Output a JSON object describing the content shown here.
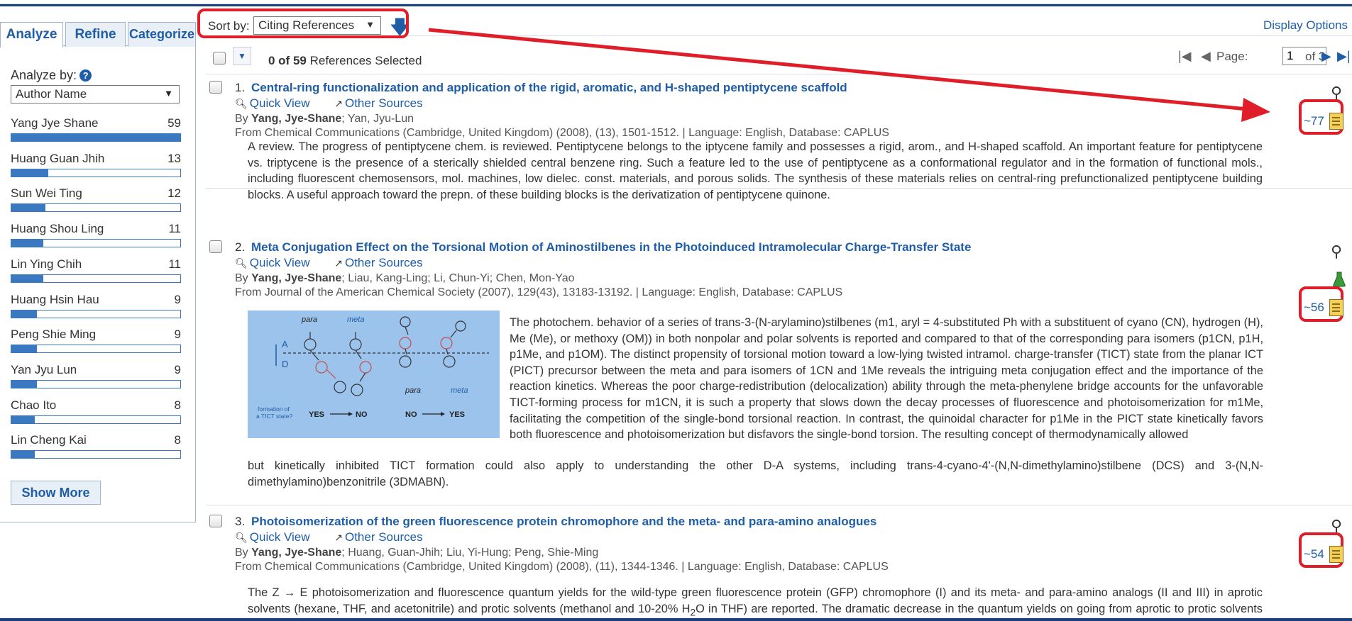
{
  "tabs": [
    {
      "label": "Analyze",
      "active": true
    },
    {
      "label": "Refine",
      "active": false
    },
    {
      "label": "Categorize",
      "active": false
    }
  ],
  "analyze": {
    "label": "Analyze by:",
    "select_value": "Author Name",
    "authors": [
      {
        "name": "Yang Jye Shane",
        "count": "59",
        "fraction": 1.0
      },
      {
        "name": "Huang Guan Jhih",
        "count": "13",
        "fraction": 0.22
      },
      {
        "name": "Sun Wei Ting",
        "count": "12",
        "fraction": 0.2
      },
      {
        "name": "Huang Shou Ling",
        "count": "11",
        "fraction": 0.19
      },
      {
        "name": "Lin Ying Chih",
        "count": "11",
        "fraction": 0.19
      },
      {
        "name": "Huang Hsin Hau",
        "count": "9",
        "fraction": 0.15
      },
      {
        "name": "Peng Shie Ming",
        "count": "9",
        "fraction": 0.15
      },
      {
        "name": "Yan Jyu Lun",
        "count": "9",
        "fraction": 0.15
      },
      {
        "name": "Chao Ito",
        "count": "8",
        "fraction": 0.14
      },
      {
        "name": "Lin Cheng Kai",
        "count": "8",
        "fraction": 0.14
      }
    ],
    "show_more": "Show More"
  },
  "sort": {
    "label": "Sort by:",
    "value": "Citing References",
    "direction_icon": "sort-descending-arrow"
  },
  "display_options": "Display Options",
  "selection": {
    "count": "0 of 59",
    "suffix": "References Selected"
  },
  "pager": {
    "label": "Page:",
    "value": "1",
    "of": "of 3"
  },
  "records": [
    {
      "num": "1.",
      "title": "Central-ring functionalization and application of the rigid, aromatic, and H-shaped pentiptycene scaffold",
      "quick_view": "Quick View",
      "other_sources": "Other Sources",
      "by_prefix": "By ",
      "by_bold": "Yang, Jye-Shane",
      "by_rest": "; Yan, Jyu-Lun",
      "from": "From Chemical Communications (Cambridge, United Kingdom) (2008), (13), 1501-1512.  |  Language: English, Database: CAPLUS",
      "abstract": "A review.  The progress of pentiptycene chem. is reviewed.  Pentiptycene belongs to the iptycene family and possesses a rigid, arom., and H-shaped scaffold.  An important feature for pentiptycene vs. triptycene is the presence of a sterically shielded central benzene ring.  Such a feature led to the use of pentiptycene as a conformational regulator and in the formation of functional mols., including fluorescent chemosensors, mol. machines, low dielec. const. materials, and porous solids.  The synthesis of these materials relies on central-ring prefunctionalized pentiptycene building blocks.  A useful approach toward the prepn. of these building blocks is the derivatization of pentiptycene quinone.",
      "cites": "~77"
    },
    {
      "num": "2.",
      "title": "Meta Conjugation Effect on the Torsional Motion of Aminostilbenes in the Photoinduced Intramolecular Charge-Transfer State",
      "quick_view": "Quick View",
      "other_sources": "Other Sources",
      "by_prefix": "By ",
      "by_bold": "Yang, Jye-Shane",
      "by_rest": "; Liau, Kang-Ling; Li, Chun-Yi; Chen, Mon-Yao",
      "from": "From Journal of the American Chemical Society (2007), 129(43), 13183-13192.  |  Language: English, Database: CAPLUS",
      "abstract": "The photochem. behavior of a series of trans-3-(N-arylamino)stilbenes (m1, aryl = 4-substituted Ph with a substituent of cyano (CN), hydrogen (H), Me (Me), or methoxy (OM)) in both nonpolar and polar solvents is reported and compared to that of the corresponding para isomers (p1CN, p1H, p1Me, and p1OM).  The distinct propensity of torsional motion toward a low-lying twisted intramol. charge-transfer (TICT) state from the planar ICT (PICT) precursor between the meta and para isomers of 1CN and 1Me reveals the intriguing meta conjugation effect and the importance of the reaction kinetics.  Whereas the poor charge-redistribution (delocalization) ability through the meta-phenylene bridge accounts for the unfavorable TICT-forming process for m1CN, it is such a property that slows down the decay processes of fluorescence and photoisomerization for m1Me, facilitating the competition of the single-bond torsional reaction.  In contrast, the quinoidal character for p1Me in the PICT state kinetically favors both fluorescence and photoisomerization but disfavors the single-bond torsion.  The resulting concept of thermodynamically allowed",
      "abstract_tail": "but kinetically inhibited TICT formation could also apply to understanding the other D-A systems, including trans-4-cyano-4'-(N,N-dimethylamino)stilbene (DCS) and 3-(N,N-dimethylamino)benzonitrile (3DMABN).",
      "graphic": {
        "para": "para",
        "meta": "meta",
        "A": "A",
        "D": "D",
        "para2": "para",
        "meta2": "meta",
        "q1": "formation of",
        "q2": "a TICT state?",
        "yes1": "YES",
        "no1": "NO",
        "no2": "NO",
        "yes2": "YES"
      },
      "cites": "~56"
    },
    {
      "num": "3.",
      "title": "Photoisomerization of the green fluorescence protein chromophore and the meta- and para-amino analogues",
      "quick_view": "Quick View",
      "other_sources": "Other Sources",
      "by_prefix": "By ",
      "by_bold": "Yang, Jye-Shane",
      "by_rest": "; Huang, Guan-Jhih; Liu, Yi-Hung; Peng, Shie-Ming",
      "from": "From Chemical Communications (Cambridge, United Kingdom) (2008), (11), 1344-1346.  |  Language: English, Database: CAPLUS",
      "abstract_a": "The Z → E photoisomerization and fluorescence quantum yields for the wild-type green fluorescence protein (GFP) chromophore (I) and its meta- and para-amino analogs (II and III) in aprotic solvents (hexane, THF, and acetonitrile) and protic solvents (methanol and 10-20% H",
      "abstract_sub": "2",
      "abstract_b": "O in THF) are reported.  The dramatic decrease in the quantum yields on going from aprotic to protic solvents indicates the important role of solvent-solute hydrogen bonding in the nonradiative decay pathways.  The enhanced fluorescence of II is",
      "cites": "~54"
    }
  ],
  "colors": {
    "link": "#1f5da6",
    "highlight": "#e01e2a",
    "header_bar": "#1a3f7a"
  }
}
